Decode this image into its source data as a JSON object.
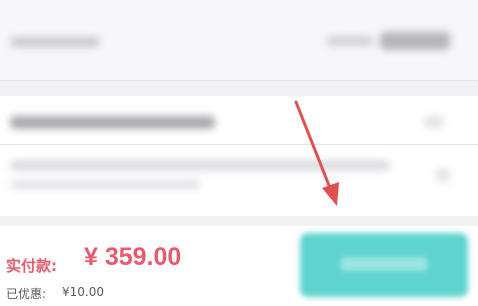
{
  "footer": {
    "pay_label": "实付款:",
    "pay_amount": "¥ 359.00",
    "discount_label": "已优惠:",
    "discount_amount": "¥10.00"
  },
  "colors": {
    "accent_red": "#e85a6e",
    "button_teal": "#5fd3cf",
    "annotation_arrow": "#e05050"
  },
  "icons": [
    "chevron-right-icon",
    "annotation-arrow"
  ]
}
